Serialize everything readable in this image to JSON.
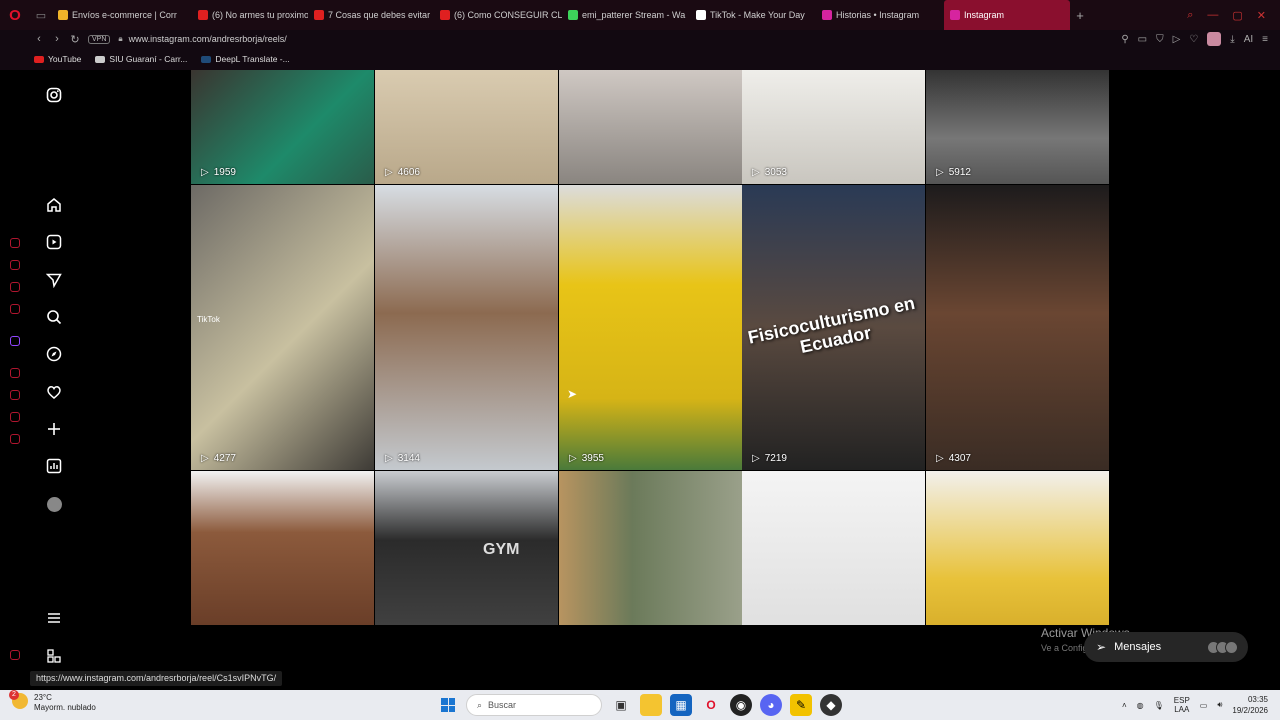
{
  "browser": {
    "tabs": [
      {
        "label": "Envíos e-commerce | Corr",
        "color": "#f0b429"
      },
      {
        "label": "(6) No armes tu proximo c",
        "color": "#e02020"
      },
      {
        "label": "7 Cosas que debes evitar",
        "color": "#e02020"
      },
      {
        "label": "(6) Como CONSEGUIR CLI",
        "color": "#e02020"
      },
      {
        "label": "emi_patterer Stream - Wa",
        "color": "#3dd35a"
      },
      {
        "label": "TikTok - Make Your Day",
        "color": "#ffffff"
      },
      {
        "label": "Historias • Instagram",
        "color": "#d6249f"
      },
      {
        "label": "Instagram",
        "color": "#d6249f"
      }
    ],
    "new_tab": "+",
    "vpn_label": "VPN",
    "url": "www.instagram.com/andresrborja/reels/",
    "ai_label": "AI",
    "bookmarks": [
      {
        "label": "YouTube",
        "color": "#e02020"
      },
      {
        "label": "SIU Guaraní - Carr...",
        "color": "#cccccc"
      },
      {
        "label": "DeepL Translate -...",
        "color": "#0f2b46"
      }
    ]
  },
  "instagram": {
    "nav_icons": [
      "instagram-logo-icon",
      "home-icon",
      "reels-icon",
      "messages-icon",
      "search-icon",
      "explore-icon",
      "notifications-icon",
      "create-icon",
      "dashboard-icon",
      "profile-avatar",
      "menu-icon",
      "threads-icon"
    ],
    "reels": [
      {
        "views": "1959",
        "bg": "linear-gradient(135deg,#3a3530,#1e8a6a 60%,#2a5c4a)"
      },
      {
        "views": "4606",
        "bg": "linear-gradient(180deg,#d9cbb0,#b9a88a)"
      },
      {
        "views": "",
        "bg": "linear-gradient(180deg,#cfc8c3,#8a8580)"
      },
      {
        "views": "3053",
        "bg": "linear-gradient(180deg,#efeeea,#c9c6bf)"
      },
      {
        "views": "5912",
        "bg": "linear-gradient(180deg,#333,#777 60%,#555)"
      },
      {
        "views": "4277",
        "bg": "linear-gradient(135deg,#6d6a65,#c8c0a0 55%,#3e3b36)"
      },
      {
        "views": "3144",
        "bg": "linear-gradient(180deg,#d7dde3,#8c6a50 45%,#c4c9ce)"
      },
      {
        "views": "3955",
        "bg": "linear-gradient(180deg,#dcdcdc,#e8c417 35%,#d6b416 75%,#4a7a3a)"
      },
      {
        "views": "7219",
        "bg": "linear-gradient(180deg,#2a3a55,#5a4a40 50%,#222)"
      },
      {
        "views": "4307",
        "bg": "linear-gradient(180deg,#1d1b1c,#6a4632 45%,#3a2c24)"
      },
      {
        "views": "",
        "bg": "linear-gradient(180deg,#f2f2f2,#8c5a3c 40%,#6a3e28)"
      },
      {
        "views": "",
        "bg": "linear-gradient(180deg,#c9ccd0,#2b2b2b 45%,#404040)"
      },
      {
        "views": "",
        "bg": "linear-gradient(90deg,#b89460,#6b7a5a 40%,#9aa08a)"
      },
      {
        "views": "",
        "bg": "linear-gradient(180deg,#f4f4f4,#e0e0e0)"
      },
      {
        "views": "",
        "bg": "linear-gradient(180deg,#f2f0ec,#e8c23a 70%,#d9b02c)"
      }
    ],
    "overlay_text": "Fisicoculturismo en Ecuador",
    "gym_logo": "GYM",
    "tiktok_watermark": "TikTok",
    "messages_label": "Mensajes"
  },
  "windows_watermark": {
    "title": "Activar Windows",
    "subtitle": "Ve a Configuración para activar Windows."
  },
  "status_url": "https://www.instagram.com/andresrborja/reel/Cs1svIPNvTG/",
  "taskbar": {
    "weather_temp": "23°C",
    "weather_desc": "Mayorm. nublado",
    "notif_count": "2",
    "search_placeholder": "Buscar",
    "lang_top": "ESP",
    "lang_bottom": "LAA",
    "time": "03:35",
    "date": "19/2/2026"
  }
}
